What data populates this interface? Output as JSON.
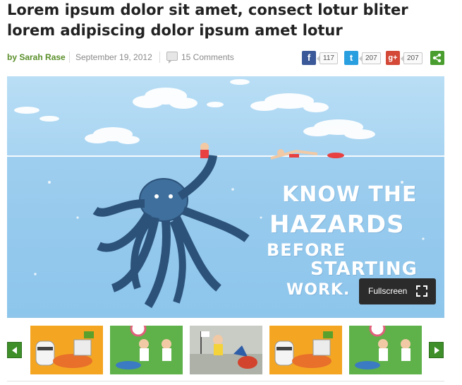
{
  "article": {
    "title": "Lorem ipsum dolor sit amet, consect lotur bliter lorem adipiscing dolor ipsum amet lotur",
    "author": "by Sarah Rase",
    "date": "September 19, 2012",
    "comments": "15 Comments"
  },
  "share": {
    "facebook": {
      "glyph": "f",
      "count": "117",
      "color": "#3b5998",
      "icon": "facebook-icon"
    },
    "twitter": {
      "glyph": "t",
      "count": "207",
      "color": "#2a9fe0",
      "icon": "twitter-icon"
    },
    "googleplus": {
      "glyph": "g+",
      "count": "207",
      "color": "#d34836",
      "icon": "google-plus-icon"
    },
    "share_all": {
      "glyph": "<",
      "color": "#4a9e2f",
      "icon": "share-icon"
    }
  },
  "hero": {
    "illustration_text": [
      "KNOW THE",
      "HAZARDS",
      "BEFORE",
      "STARTING",
      "WORK."
    ],
    "fullscreen_label": "Fullscreen",
    "fullscreen_icon": "expand-icon"
  },
  "gallery": {
    "prev_icon": "arrow-left-icon",
    "next_icon": "arrow-right-icon"
  }
}
